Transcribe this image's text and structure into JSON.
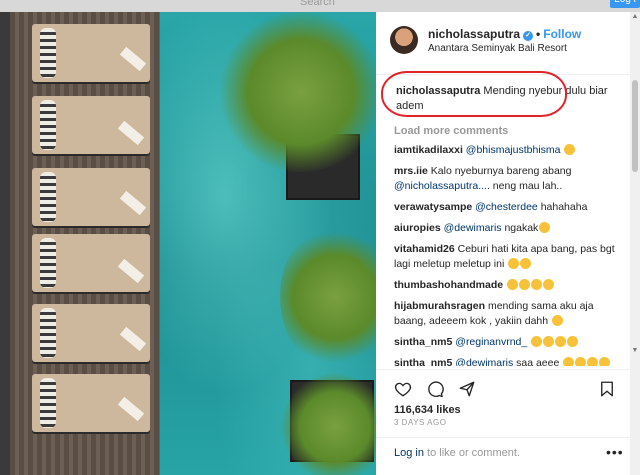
{
  "topbar": {
    "search_placeholder": "Search",
    "login_label": "Log i"
  },
  "post": {
    "username": "nicholassaputra",
    "follow_label": "Follow",
    "location": "Anantara Seminyak Bali Resort",
    "caption_user": "nicholassaputra",
    "caption_text": "Mending nyebur dulu biar adem",
    "load_more": "Load more comments",
    "comments": [
      {
        "user": "iamtikadilaxxi",
        "mention": "@bhismajustbhisma",
        "text": "",
        "emoji": 1
      },
      {
        "user": "mrs.iie",
        "mention": "",
        "text": "Kalo nyeburnya bareng abang",
        "line2_mention": "@nicholassaputra....",
        "line2_text": "neng mau lah..",
        "emoji": 0
      },
      {
        "user": "verawatysampe",
        "mention": "@chesterdee",
        "text": "hahahaha",
        "emoji": 0
      },
      {
        "user": "aiuropies",
        "mention": "@dewimaris",
        "text": "ngakak",
        "emoji": 1
      },
      {
        "user": "vitahamid26",
        "mention": "",
        "text": "Ceburi hati kita apa bang, pas bgt lagi meletup meletup ini",
        "emoji": 2
      },
      {
        "user": "thumbashohandmade",
        "mention": "",
        "text": "",
        "emoji": 4
      },
      {
        "user": "hijabmurahsragen",
        "mention": "",
        "text": "mending sama aku aja baang, adeeem kok , yakiin dahh",
        "emoji": 1
      },
      {
        "user": "sintha_nm5",
        "mention": "@reginanvrnd_",
        "text": "",
        "emoji": 4
      },
      {
        "user": "sintha_nm5",
        "mention": "@dewimaris",
        "text": "saa aeee",
        "emoji": 6
      }
    ],
    "likes": "116,634 likes",
    "time_ago": "3 DAYS AGO",
    "login_link": "Log in",
    "login_text": " to like or comment."
  },
  "icons": [
    "heart-icon",
    "comment-icon",
    "share-icon",
    "bookmark-icon",
    "more-icon",
    "verified-icon"
  ],
  "colors": {
    "accent": "#3897f0",
    "highlight": "#e0242a",
    "pool": "#1d8e92"
  }
}
